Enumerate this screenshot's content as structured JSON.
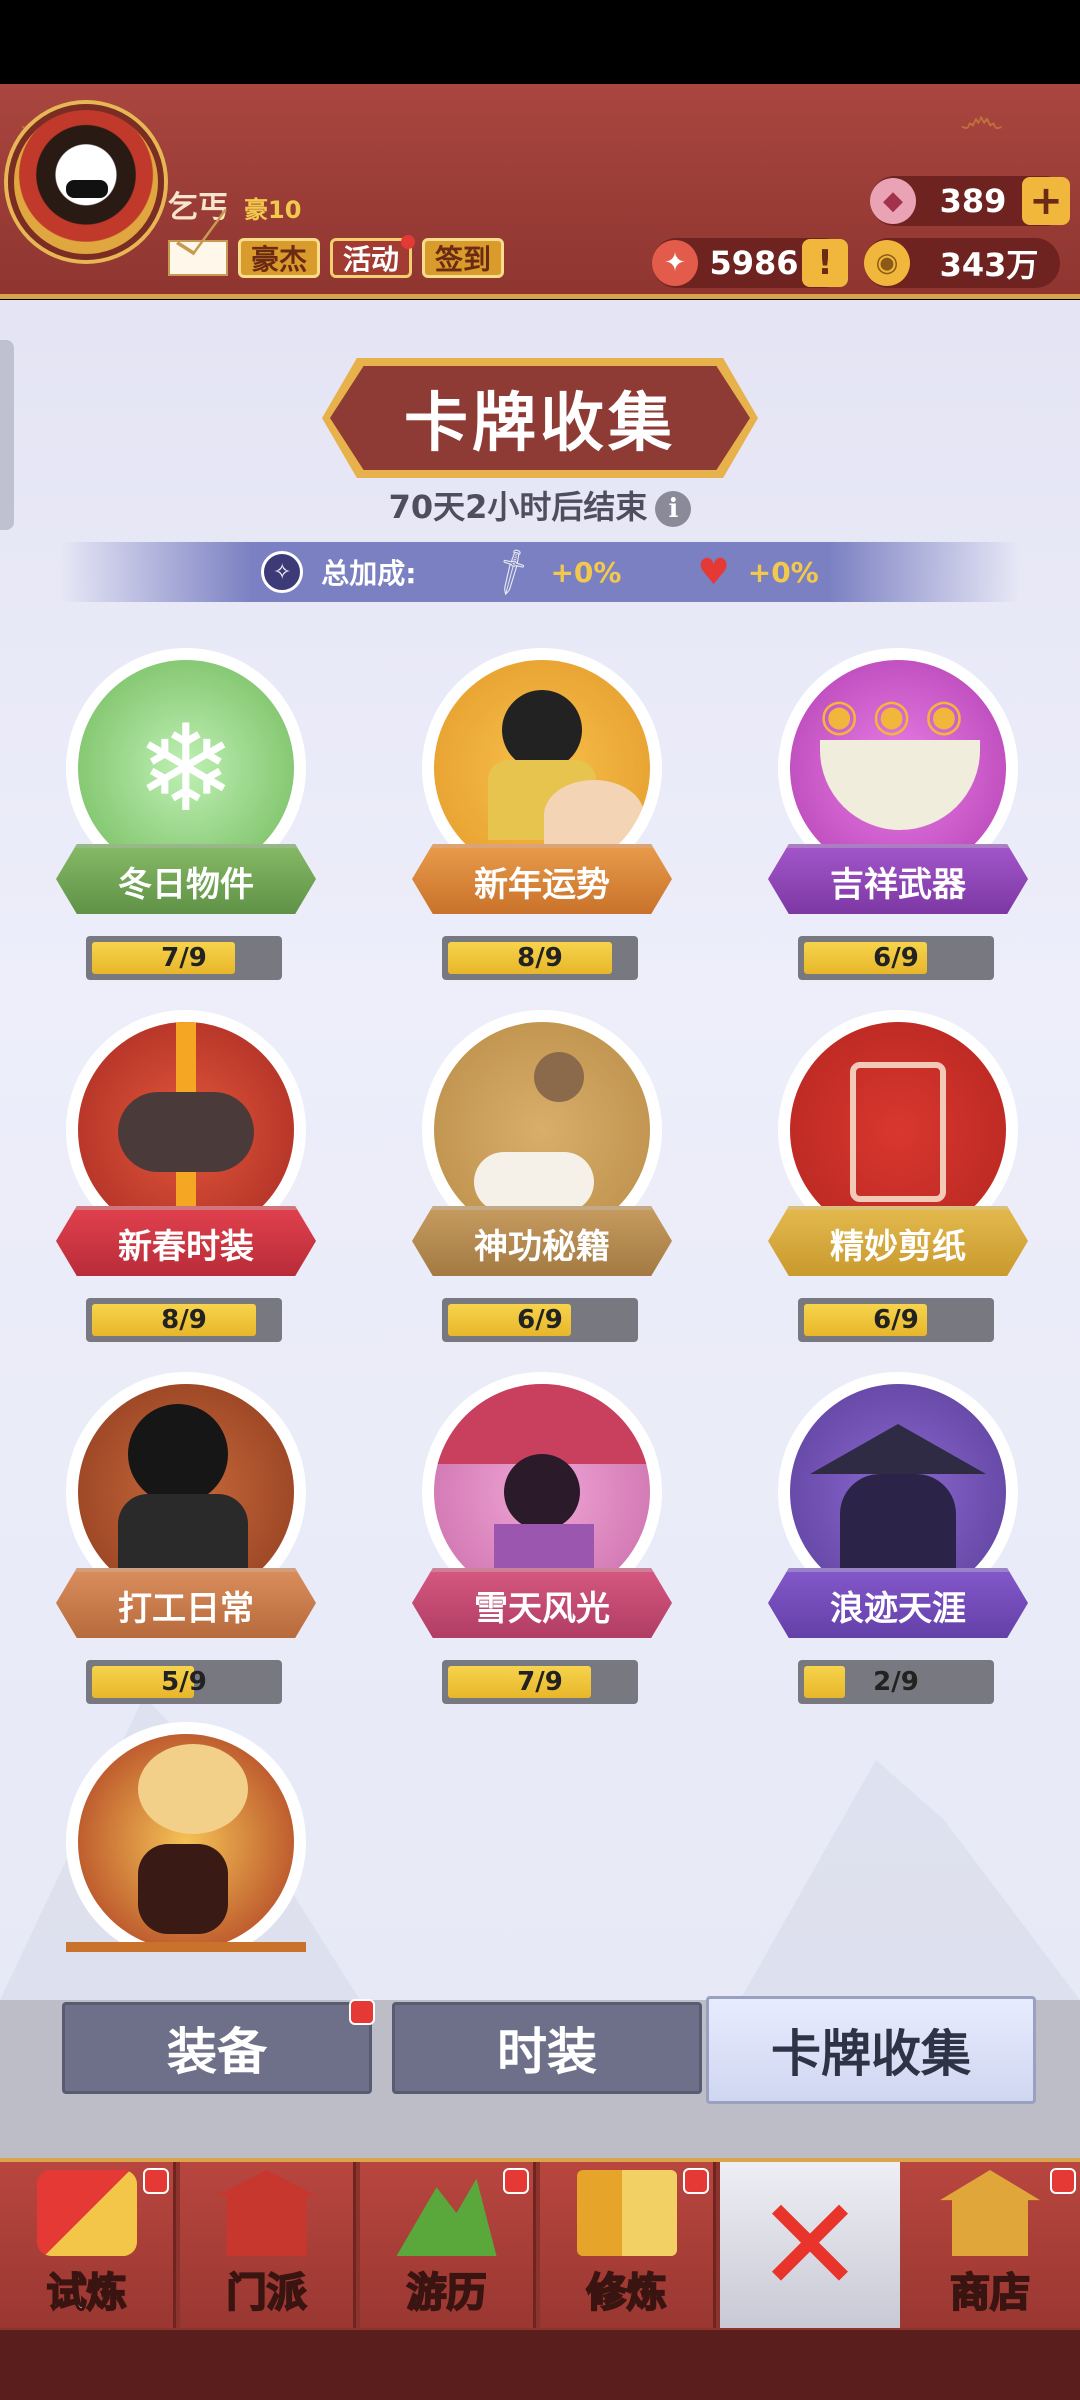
{
  "header": {
    "username": "乞丐",
    "vip": "豪10",
    "buttons": [
      "豪杰",
      "活动",
      "签到"
    ],
    "gems": "389",
    "honor": "5986",
    "coins": "343万"
  },
  "page": {
    "title": "卡牌收集",
    "countdown": "70天2小时后结束",
    "bonus_label": "总加成:",
    "attack_bonus": "+0%",
    "hp_bonus": "+0%"
  },
  "cards": [
    {
      "name": "冬日物件",
      "progress": "7/9",
      "value": 7,
      "total": 9
    },
    {
      "name": "新年运势",
      "progress": "8/9",
      "value": 8,
      "total": 9
    },
    {
      "name": "吉祥武器",
      "progress": "6/9",
      "value": 6,
      "total": 9
    },
    {
      "name": "新春时装",
      "progress": "8/9",
      "value": 8,
      "total": 9
    },
    {
      "name": "神功秘籍",
      "progress": "6/9",
      "value": 6,
      "total": 9
    },
    {
      "name": "精妙剪纸",
      "progress": "6/9",
      "value": 6,
      "total": 9
    },
    {
      "name": "打工日常",
      "progress": "5/9",
      "value": 5,
      "total": 9
    },
    {
      "name": "雪天风光",
      "progress": "7/9",
      "value": 7,
      "total": 9
    },
    {
      "name": "浪迹天涯",
      "progress": "2/9",
      "value": 2,
      "total": 9
    }
  ],
  "tabs": [
    "装备",
    "时装",
    "卡牌收集"
  ],
  "nav": [
    "试炼",
    "门派",
    "游历",
    "修炼",
    "商店"
  ],
  "colors": {
    "header_red": "#a9463f",
    "gold": "#f0b73c",
    "progress_fill": "#e8b62a"
  }
}
